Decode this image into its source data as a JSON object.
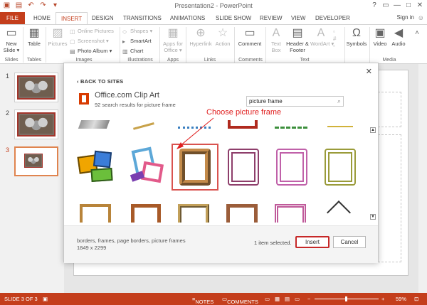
{
  "window": {
    "title": "Presentation2 - PowerPoint",
    "qat_icons": [
      "powerpoint-icon",
      "save-icon",
      "undo-icon",
      "redo-icon",
      "customize-icon"
    ],
    "controls": [
      "?",
      "▭",
      "—",
      "□",
      "✕"
    ]
  },
  "ribbon_tabs": {
    "file": "FILE",
    "items": [
      "HOME",
      "INSERT",
      "DESIGN",
      "TRANSITIONS",
      "ANIMATIONS",
      "SLIDE SHOW",
      "REVIEW",
      "VIEW",
      "DEVELOPER"
    ],
    "active": "INSERT",
    "sign_in": "Sign in"
  },
  "ribbon": {
    "new_slide": "New Slide ▾",
    "table": "Table",
    "pictures": "Pictures",
    "online_pictures": "Online Pictures",
    "screenshot": "Screenshot ▾",
    "photo_album": "Photo Album ▾",
    "shapes": "Shapes ▾",
    "smartart": "SmartArt",
    "chart": "Chart",
    "apps_for_office": "Apps for Office ▾",
    "hyperlink": "Hyperlink",
    "action": "Action",
    "comment": "Comment",
    "text_box": "Text Box",
    "header_footer": "Header & Footer",
    "wordart": "WordArt ▾",
    "symbols": "Symbols",
    "video": "Video",
    "audio": "Audio",
    "groups": {
      "slides": "Slides",
      "tables": "Tables",
      "images": "Images",
      "illustrations": "Illustrations",
      "apps": "Apps",
      "links": "Links",
      "comments": "Comments",
      "text": "Text",
      "media": "Media"
    }
  },
  "thumbnails": [
    {
      "number": "1",
      "selected": false
    },
    {
      "number": "2",
      "selected": false
    },
    {
      "number": "3",
      "selected": true
    }
  ],
  "dialog": {
    "back_link": "BACK TO SITES",
    "source_title": "Office.com Clip Art",
    "result_summary": "92 search results for picture frame",
    "search_value": "picture frame",
    "selected_keywords": "borders, frames, page borders, picture frames",
    "selected_dimensions": "1849 x 2299",
    "selection_count": "1 item selected.",
    "insert_label": "Insert",
    "cancel_label": "Cancel"
  },
  "annotation": {
    "text": "Choose picture frame",
    "color": "#e02020"
  },
  "statusbar": {
    "slide_info": "SLIDE 3 OF 3",
    "notes": "NOTES",
    "comments": "COMMENTS",
    "zoom": "59%"
  },
  "colors": {
    "accent": "#c43e1c",
    "selection_outline": "#d9534f"
  }
}
